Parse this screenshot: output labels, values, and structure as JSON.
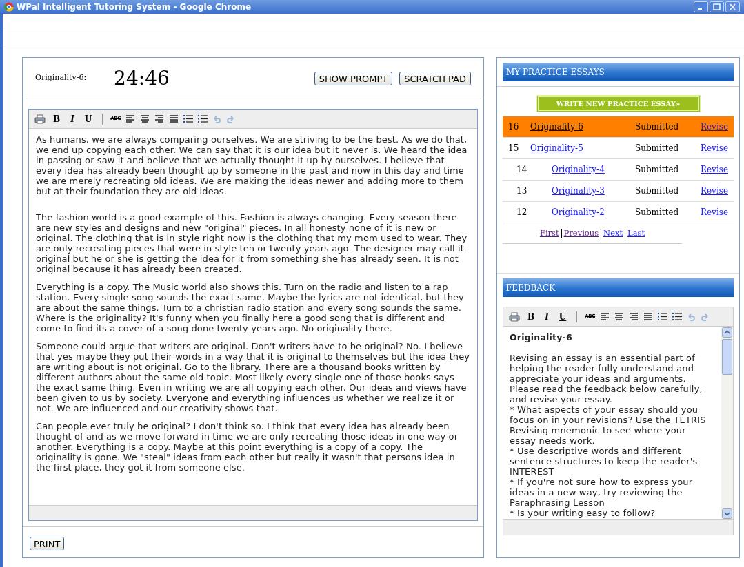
{
  "window": {
    "title": "WPal Intelligent Tutoring System - Google Chrome"
  },
  "essay": {
    "label": "Originality-6:",
    "timer": "24:46",
    "buttons": [
      "SHOW PROMPT",
      "SCRATCH PAD"
    ],
    "toolbar": [
      {
        "kind": "print"
      },
      {
        "kind": "bold",
        "label": "B"
      },
      {
        "kind": "italic",
        "label": "I"
      },
      {
        "kind": "underline",
        "label": "U"
      },
      {
        "kind": "separator"
      },
      {
        "kind": "spell",
        "label": "ABC"
      },
      {
        "kind": "align-left"
      },
      {
        "kind": "align-center"
      },
      {
        "kind": "align-right"
      },
      {
        "kind": "justify"
      },
      {
        "kind": "bullets"
      },
      {
        "kind": "numbers"
      },
      {
        "kind": "undo",
        "disabled": true
      },
      {
        "kind": "redo",
        "disabled": true
      }
    ],
    "paragraphs": [
      "As humans, we are always comparing ourselves. We are striving to be the best. As we do that, we end up copying each other. We can say that it is our idea but it never is. We heard the idea in passing or saw it and believe that we actually thought it up by ourselves. I believe that every idea has already been thought up by someone in the past and now in this day and time we are merely recreating old ideas. We are making the ideas newer and adding more to them but at their foundation they are old ideas.",
      "The fashion world is a good example of this. Fashion is always changing. Every season there are new styles and designs and new \"original\" pieces. In all honesty none of it is new or original. The clothing that is in style right now is the clothing that my mom used to wear. They are only recreating pieces that were in style ten or twenty years ago. The designer may call it original but he or she is getting the idea for it from something she has already seen. It is not original because it has already been created.",
      "Everything is a copy. The Music world also shows this. Turn on the radio and listen to a rap station. Every single song sounds the exact same. Maybe the lyrics are not identical, but they are about the same things. Turn to a christian radio station and every song sounds the same. Where is the originality? It's funny when you finally here a good song that is different and come to find its a cover of a song done twenty years ago. No originality there.",
      "Someone could argue that writers are original. Don't writers have to be original? No. I believe that yes maybe they put their words in a way that it is original to themselves but the idea they are writing about is not original. Go to the library. There are a thousand books written by different authors about the same old topic. Most likely every single one of those books says the exact same thing. Even in writing we are all copying each other. Our ideas and views have been given to us by society. Everyone and everything influences us whether we realize it or not. We are influenced and our creativity shows that.",
      "Can people ever truly be original? I don't think so. I think that every idea has already been thought of and as we move forward in time we are only recreating those ideas in one way or another. Everything is a copy. Maybe at this point everything is a copy of a copy. The originality is gone. We \"steal\" ideas from each other but really it wasn't that persons idea in the first place, they got it from someone else."
    ],
    "print_button": "PRINT"
  },
  "practice_essays": {
    "title": "MY PRACTICE ESSAYS",
    "new_button": "WRITE NEW PRACTICE ESSAY»",
    "rows": [
      {
        "number": "16",
        "name": "Originality-6",
        "status": "Submitted",
        "action": "Revise",
        "selected": true
      },
      {
        "number": "15",
        "name": "Originality-5",
        "status": "Submitted",
        "action": "Revise",
        "selected": false
      },
      {
        "number": "14",
        "name": "Originality-4",
        "status": "Submitted",
        "action": "Revise",
        "selected": false
      },
      {
        "number": "13",
        "name": "Originality-3",
        "status": "Submitted",
        "action": "Revise",
        "selected": false
      },
      {
        "number": "12",
        "name": "Originality-2",
        "status": "Submitted",
        "action": "Revise",
        "selected": false
      }
    ],
    "pager": [
      "First",
      "Previous",
      "Next",
      "Last"
    ]
  },
  "feedback": {
    "title": "FEEDBACK",
    "heading": "Originality-6",
    "toolbar": [
      {
        "kind": "print"
      },
      {
        "kind": "bold",
        "label": "B"
      },
      {
        "kind": "italic",
        "label": "I"
      },
      {
        "kind": "underline",
        "label": "U"
      },
      {
        "kind": "separator"
      },
      {
        "kind": "spell",
        "label": "ABC"
      },
      {
        "kind": "align-left"
      },
      {
        "kind": "align-center"
      },
      {
        "kind": "align-right"
      },
      {
        "kind": "justify"
      },
      {
        "kind": "bullets"
      },
      {
        "kind": "numbers"
      },
      {
        "kind": "undo",
        "disabled": true
      },
      {
        "kind": "redo",
        "disabled": true
      }
    ],
    "lines": [
      "Revising an essay is an essential part of helping the reader fully understand and appreciate your ideas and arguments. Please read the feedback below carefully, and revise your essay.",
      "* What aspects of your essay should you focus on in your revisions? Use the TETRIS Revising mnemonic to see where your essay needs work.",
      "* Use descriptive words and different sentence structures to keep the reader's INTEREST",
      "* If you're not sure how to express your ideas in a new way, try reviewing the Paraphrasing Lesson",
      "* Is your writing easy to follow?"
    ]
  }
}
